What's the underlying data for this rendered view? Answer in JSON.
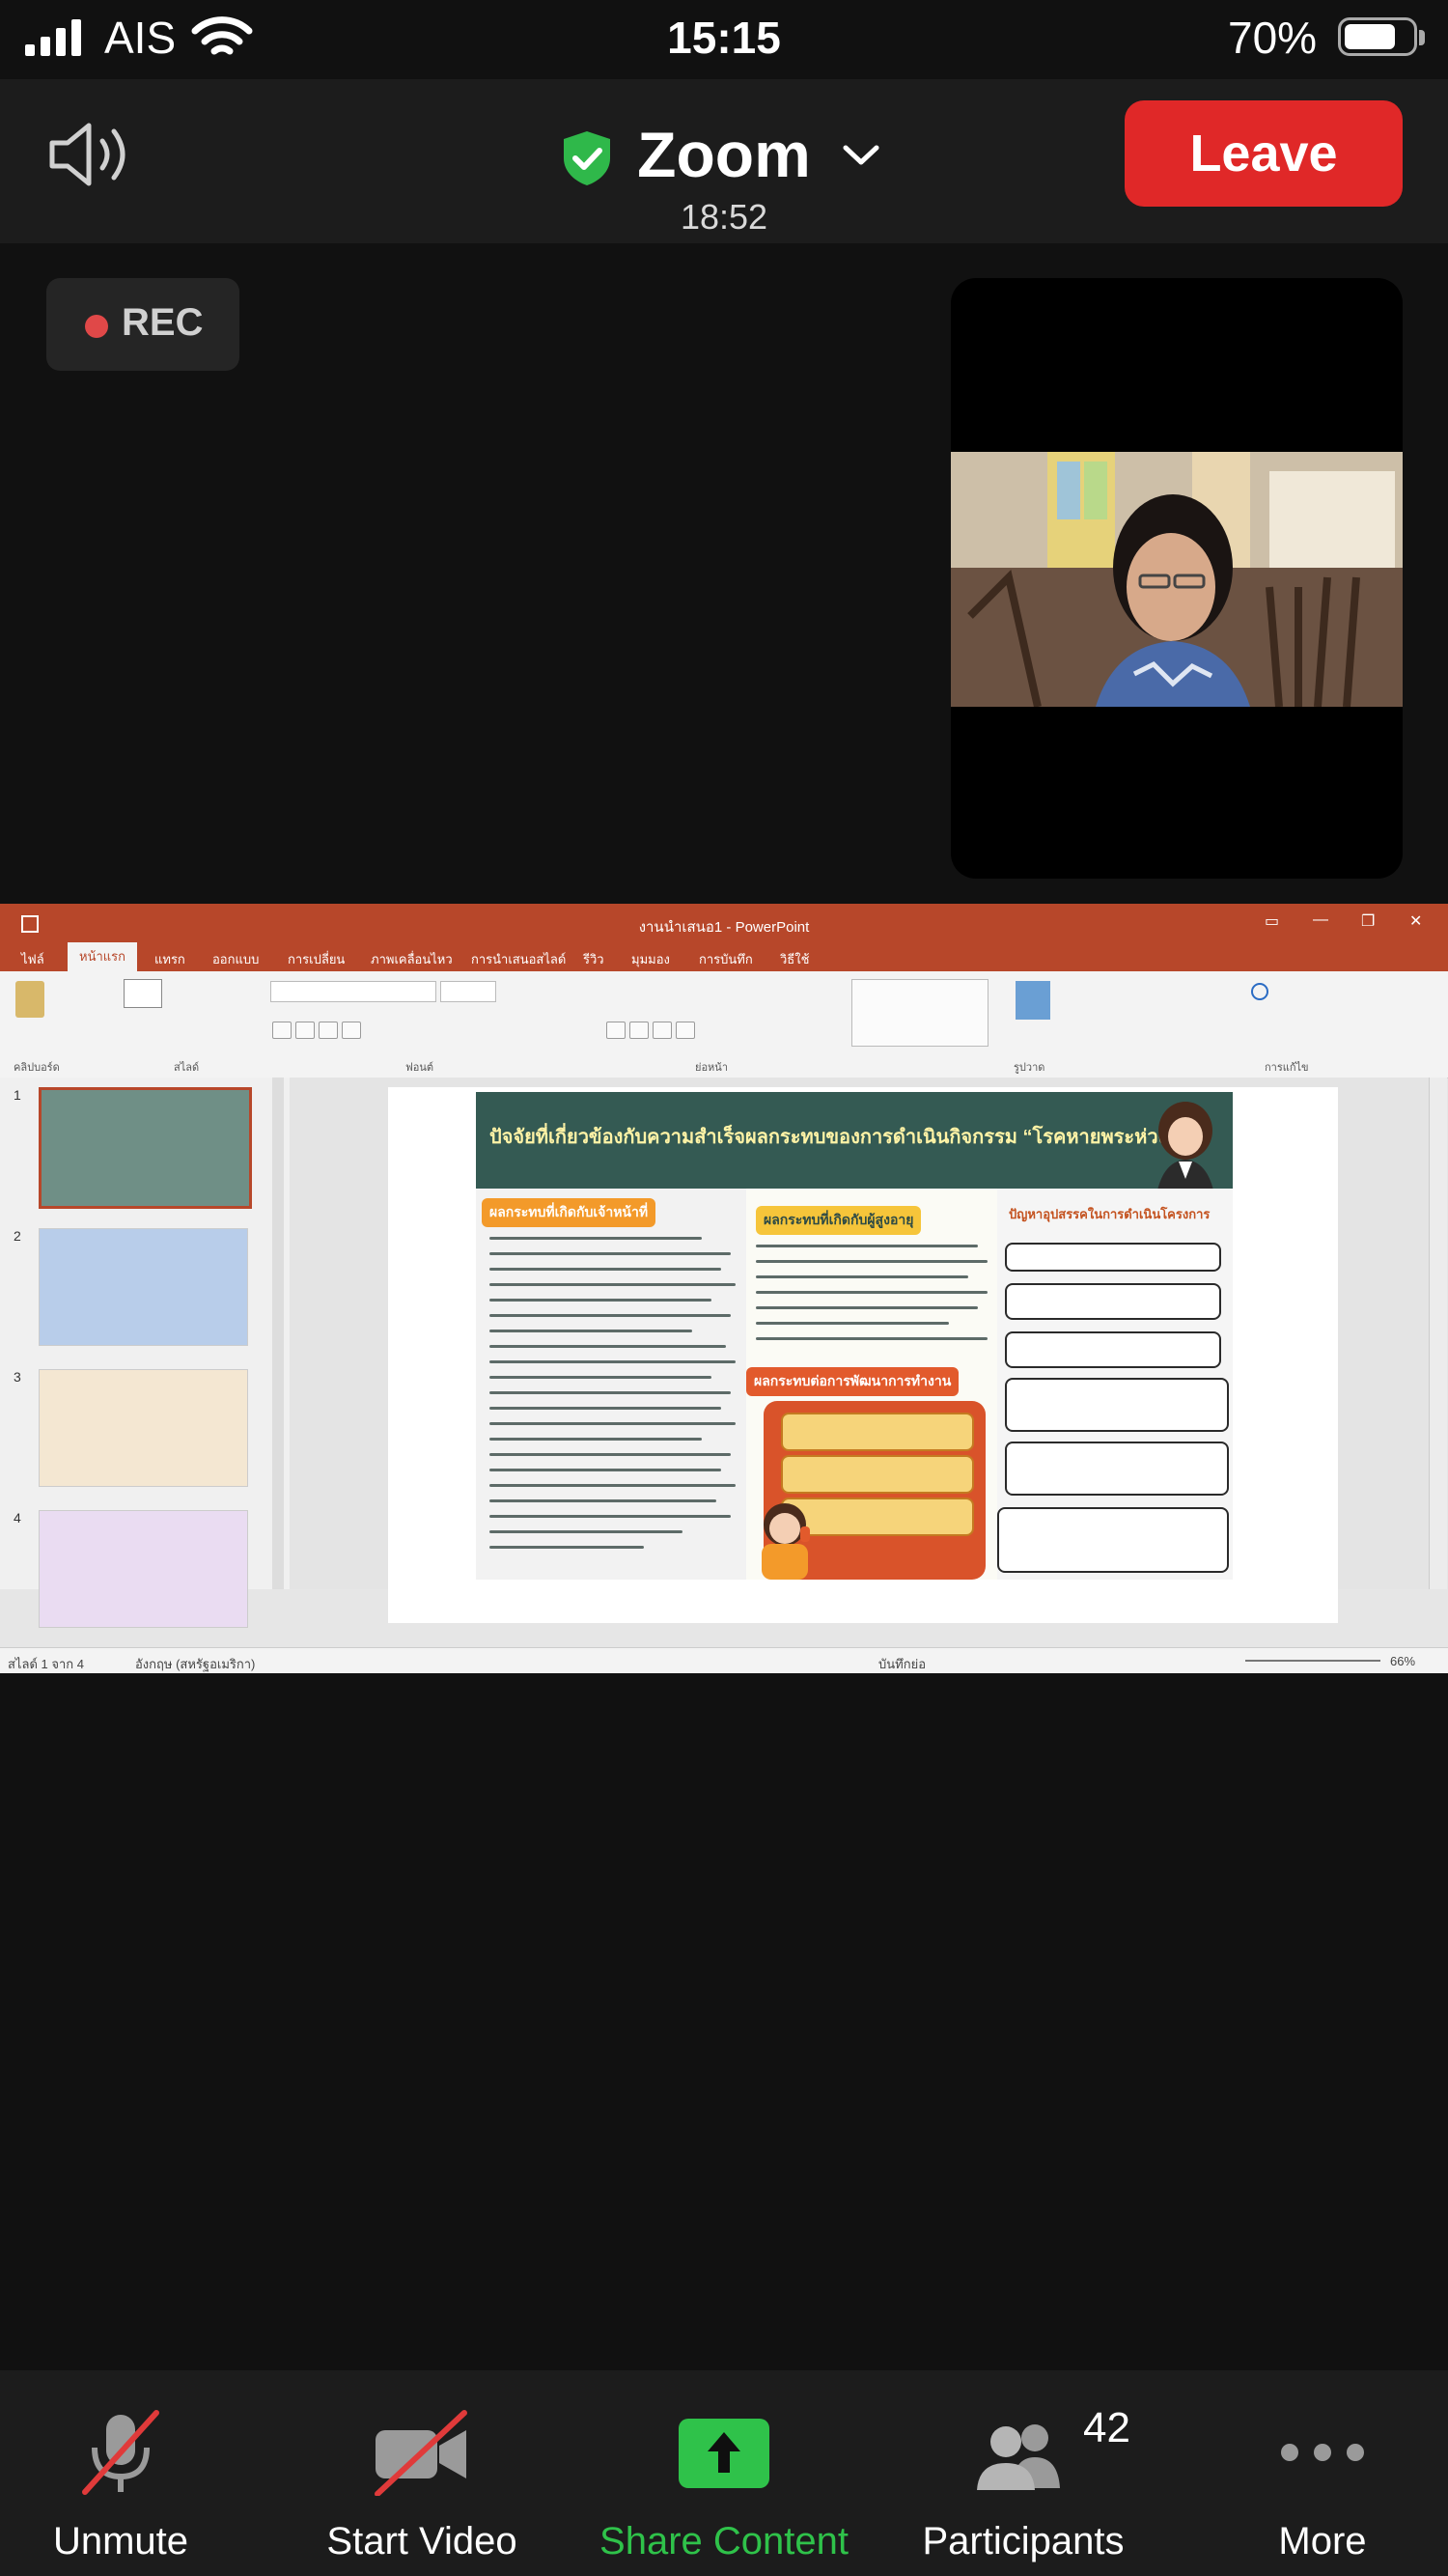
{
  "status_bar": {
    "carrier": "AIS",
    "time": "15:15",
    "battery": "70%"
  },
  "header": {
    "title": "Zoom",
    "meeting_time": "18:52",
    "leave_label": "Leave"
  },
  "video": {
    "rec_label": "REC"
  },
  "shared_screen": {
    "app_title": "งานนำเสนอ1 - PowerPoint",
    "ribbon_tabs": [
      "ไฟล์",
      "หน้าแรก",
      "แทรก",
      "ออกแบบ",
      "การเปลี่ยน",
      "ภาพเคลื่อนไหว",
      "การนำเสนอสไลด์",
      "รีวิว",
      "มุมมอง",
      "การบันทึก",
      "วิธีใช้"
    ],
    "thumb_numbers": [
      "1",
      "2",
      "3",
      "4"
    ],
    "status_left": "สไลด์ 1 จาก 4",
    "status_lang": "อังกฤษ (สหรัฐอเมริกา)",
    "status_notes": "บันทึกย่อ",
    "status_zoom": "66%",
    "slide": {
      "title": "ปัจจัยที่เกี่ยวข้องกับความสำเร็จผลกระทบของการดำเนินกิจกรรม “โรคหายพระห่วงใย”",
      "col1_head": "ผลกระทบที่เกิดกับเจ้าหน้าที่",
      "col2_head": "ผลกระทบที่เกิดกับผู้สูงอายุ",
      "col2b_head": "ผลกระทบต่อการพัฒนาการทำงาน",
      "col3_head": "ปัญหาอุปสรรคในการดำเนินโครงการ"
    }
  },
  "toolbar": {
    "unmute": "Unmute",
    "start_video": "Start Video",
    "share_content": "Share Content",
    "participants": "Participants",
    "participant_count": "42",
    "more": "More"
  },
  "colors": {
    "leave": "#e02828",
    "share_green": "#2fc24a",
    "rec_dot": "#e04848",
    "ppt_accent": "#b7472a"
  }
}
